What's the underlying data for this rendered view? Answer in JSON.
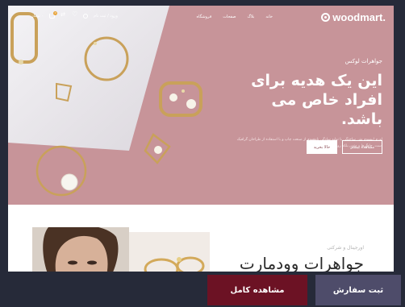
{
  "header": {
    "logo_text": "woodmart.",
    "nav": [
      "خانه",
      "بلاگ",
      "صفحات",
      "فروشگاه"
    ],
    "login_label": "ورود / ثبت نام",
    "cart_total": "۰ تومان",
    "icons": [
      "search-icon",
      "heart-icon",
      "compare-icon",
      "cart-icon"
    ]
  },
  "hero": {
    "eyebrow": "جواهرات لوکس",
    "headline_line1": "این یک هدیه برای",
    "headline_line2": "افراد خاص می باشد.",
    "description": "لورم ایپسوم متن ساختگی با تولید سادگی نامفهوم از صنعت چاپ و با استفاده از طراحان گرافیک است. چاپگرها و متون بلکه روزنامه و مجله",
    "button_outline": "مشاهده بیشتر",
    "button_solid": "حالا بخرید",
    "colors": {
      "background": "#c79499"
    }
  },
  "section": {
    "eyebrow": "اورجینال و شرکتی",
    "title": "جواهرات وودمارت"
  },
  "actions": {
    "order_label": "ثبت سفارش",
    "view_label": "مشاهده کامل",
    "colors": {
      "order": "#4e4c6a",
      "view": "#6c1224"
    }
  }
}
